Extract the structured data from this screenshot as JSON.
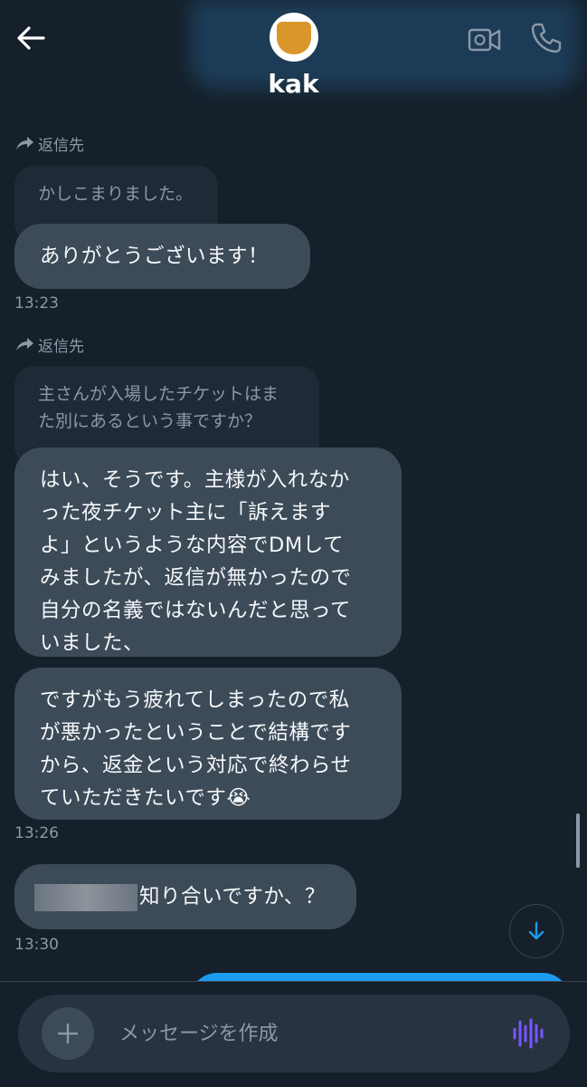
{
  "header": {
    "name": "kak",
    "back_icon": "arrow-left-icon",
    "video_icon": "video-call-icon",
    "phone_icon": "phone-icon"
  },
  "messages": [
    {
      "reply_label": "返信先",
      "quoted_lines": [
        "かしこまりました。"
      ],
      "bubble_lines": [
        "ありがとうございます！"
      ],
      "time": "13:23"
    },
    {
      "reply_label": "返信先",
      "quoted_lines": [
        "主さんが入場したチケットはま",
        "た別にあるという事ですか？"
      ],
      "bubble1_lines": [
        "はい、そうです。主様が入れなか",
        "った夜チケット主に「訴えます",
        "よ」というような内容でDMして",
        "みましたが、返信が無かったので",
        "自分の名義ではないんだと思って",
        "いました、"
      ],
      "bubble2_lines": [
        "ですがもう疲れてしまったので私",
        "が悪かったということで結構です",
        "から、返金という対応で終わらせ",
        "ていただきたいです😭"
      ],
      "time": "13:26"
    },
    {
      "bubble_text": "知り合いですか、？",
      "time": "13:30"
    }
  ],
  "composer": {
    "placeholder": "メッセージを作成"
  },
  "colors": {
    "background": "#15202b",
    "bubble": "#3d4a58",
    "accent": "#1d9bf0",
    "voice": "#7856ff"
  }
}
